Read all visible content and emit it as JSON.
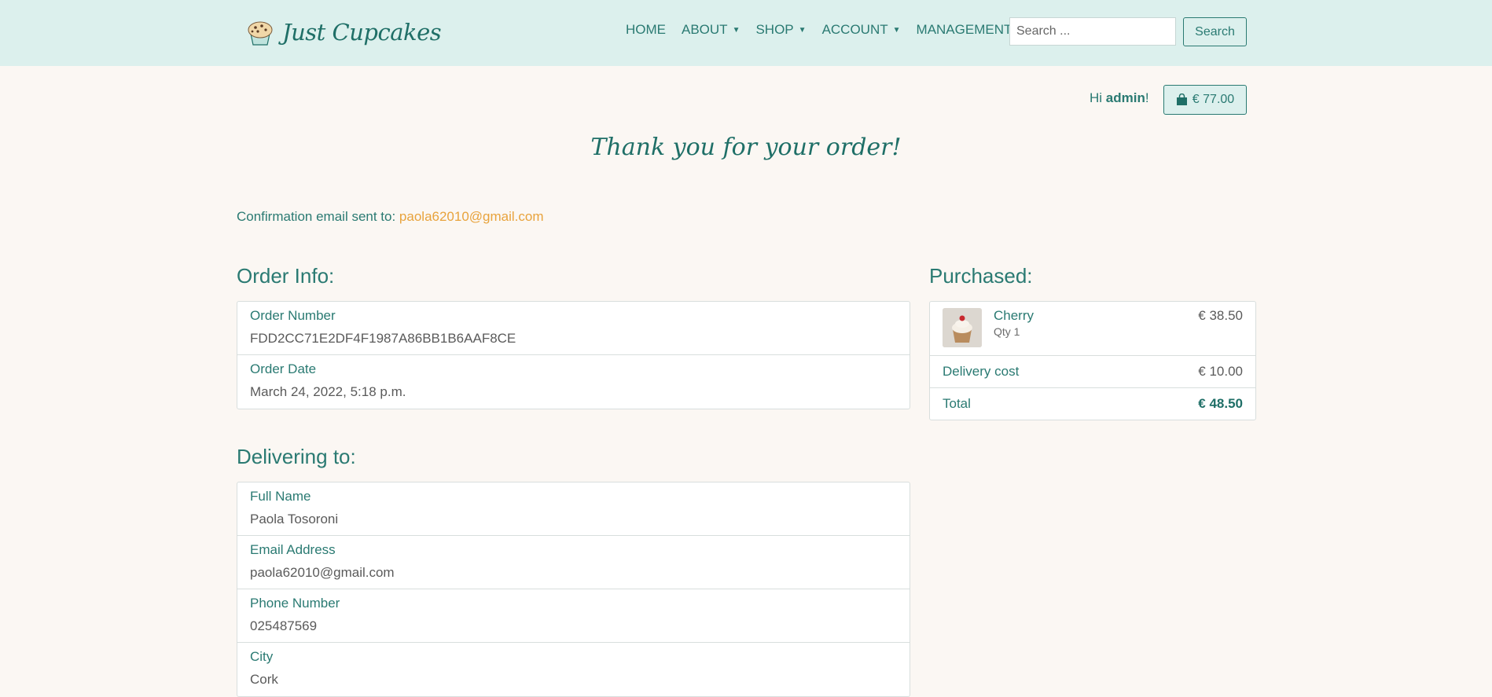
{
  "navbar": {
    "brand": "Just Cupcakes",
    "links": [
      {
        "label": "HOME",
        "dropdown": false
      },
      {
        "label": "ABOUT",
        "dropdown": true
      },
      {
        "label": "SHOP",
        "dropdown": true
      },
      {
        "label": "ACCOUNT",
        "dropdown": true
      },
      {
        "label": "MANAGEMENT",
        "dropdown": false
      }
    ],
    "search_placeholder": "Search ...",
    "search_button": "Search"
  },
  "user": {
    "greeting_prefix": "Hi ",
    "username": "admin",
    "greeting_suffix": "!",
    "cart_total": "€ 77.00"
  },
  "page": {
    "title": "Thank you for your order!",
    "confirm_label": "Confirmation email sent to: ",
    "confirm_email": "paola62010@gmail.com"
  },
  "order_info": {
    "heading": "Order Info:",
    "rows": [
      {
        "label": "Order Number",
        "value": "FDD2CC71E2DF4F1987A86BB1B6AAF8CE"
      },
      {
        "label": "Order Date",
        "value": "March 24, 2022, 5:18 p.m."
      }
    ]
  },
  "delivery": {
    "heading": "Delivering to:",
    "rows": [
      {
        "label": "Full Name",
        "value": "Paola Tosoroni"
      },
      {
        "label": "Email Address",
        "value": "paola62010@gmail.com"
      },
      {
        "label": "Phone Number",
        "value": "025487569"
      },
      {
        "label": "City",
        "value": "Cork"
      }
    ]
  },
  "purchased": {
    "heading": "Purchased:",
    "item": {
      "name": "Cherry",
      "qty": "Qty 1",
      "price": "€ 38.50"
    },
    "delivery_label": "Delivery cost",
    "delivery_value": "€ 10.00",
    "total_label": "Total",
    "total_value": "€ 48.50"
  },
  "colors": {
    "navbar_bg": "#dcf0ed",
    "page_bg": "#fbf7f3",
    "primary": "#2a7a72",
    "accent_email": "#e8a33c"
  },
  "icons": {
    "logo": "cupcake-logo-icon",
    "cart": "shopping-bag-icon"
  }
}
